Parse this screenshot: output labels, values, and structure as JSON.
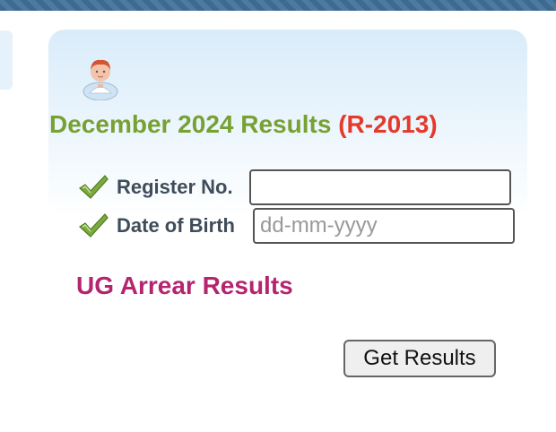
{
  "header": {
    "title": "December 2024 Results",
    "regulation": "(R-2013)"
  },
  "form": {
    "register_no": {
      "label": "Register No.",
      "value": "",
      "placeholder": ""
    },
    "date_of_birth": {
      "label": "Date of Birth",
      "value": "",
      "placeholder": "dd-mm-yyyy"
    }
  },
  "section": {
    "heading": "UG Arrear Results"
  },
  "actions": {
    "submit_label": "Get Results"
  },
  "icons": {
    "avatar": "user-avatar-icon",
    "check": "checkmark-icon"
  },
  "colors": {
    "title": "#77a133",
    "regulation": "#e43a2c",
    "section_heading": "#b5256f",
    "label": "#3f4d5a",
    "card_top": "#d9ecfa"
  }
}
